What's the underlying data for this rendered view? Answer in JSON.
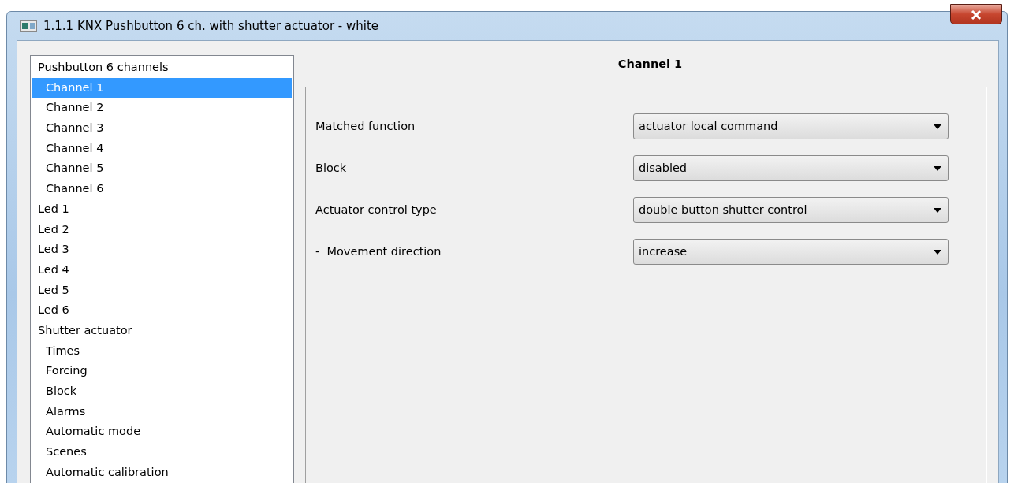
{
  "window": {
    "title": "1.1.1 KNX Pushbutton 6 ch. with shutter actuator - white"
  },
  "tree": [
    {
      "label": "Pushbutton 6 channels",
      "selected": false,
      "children": [
        {
          "label": "Channel 1",
          "selected": true
        },
        {
          "label": "Channel 2",
          "selected": false
        },
        {
          "label": "Channel 3",
          "selected": false
        },
        {
          "label": "Channel 4",
          "selected": false
        },
        {
          "label": "Channel 5",
          "selected": false
        },
        {
          "label": "Channel 6",
          "selected": false
        }
      ]
    },
    {
      "label": "Led 1",
      "selected": false
    },
    {
      "label": "Led 2",
      "selected": false
    },
    {
      "label": "Led 3",
      "selected": false
    },
    {
      "label": "Led 4",
      "selected": false
    },
    {
      "label": "Led 5",
      "selected": false
    },
    {
      "label": "Led 6",
      "selected": false
    },
    {
      "label": "Shutter actuator",
      "selected": false,
      "children": [
        {
          "label": "Times",
          "selected": false
        },
        {
          "label": "Forcing",
          "selected": false
        },
        {
          "label": "Block",
          "selected": false
        },
        {
          "label": "Alarms",
          "selected": false
        },
        {
          "label": "Automatic mode",
          "selected": false
        },
        {
          "label": "Scenes",
          "selected": false
        },
        {
          "label": "Automatic calibration",
          "selected": false
        }
      ]
    }
  ],
  "panel": {
    "title": "Channel 1",
    "params": [
      {
        "label": "Matched function",
        "value": "actuator local command"
      },
      {
        "label": "Block",
        "value": "disabled"
      },
      {
        "label": "Actuator control type",
        "value": "double button shutter control"
      },
      {
        "label": "-  Movement direction",
        "value": "increase"
      }
    ]
  }
}
